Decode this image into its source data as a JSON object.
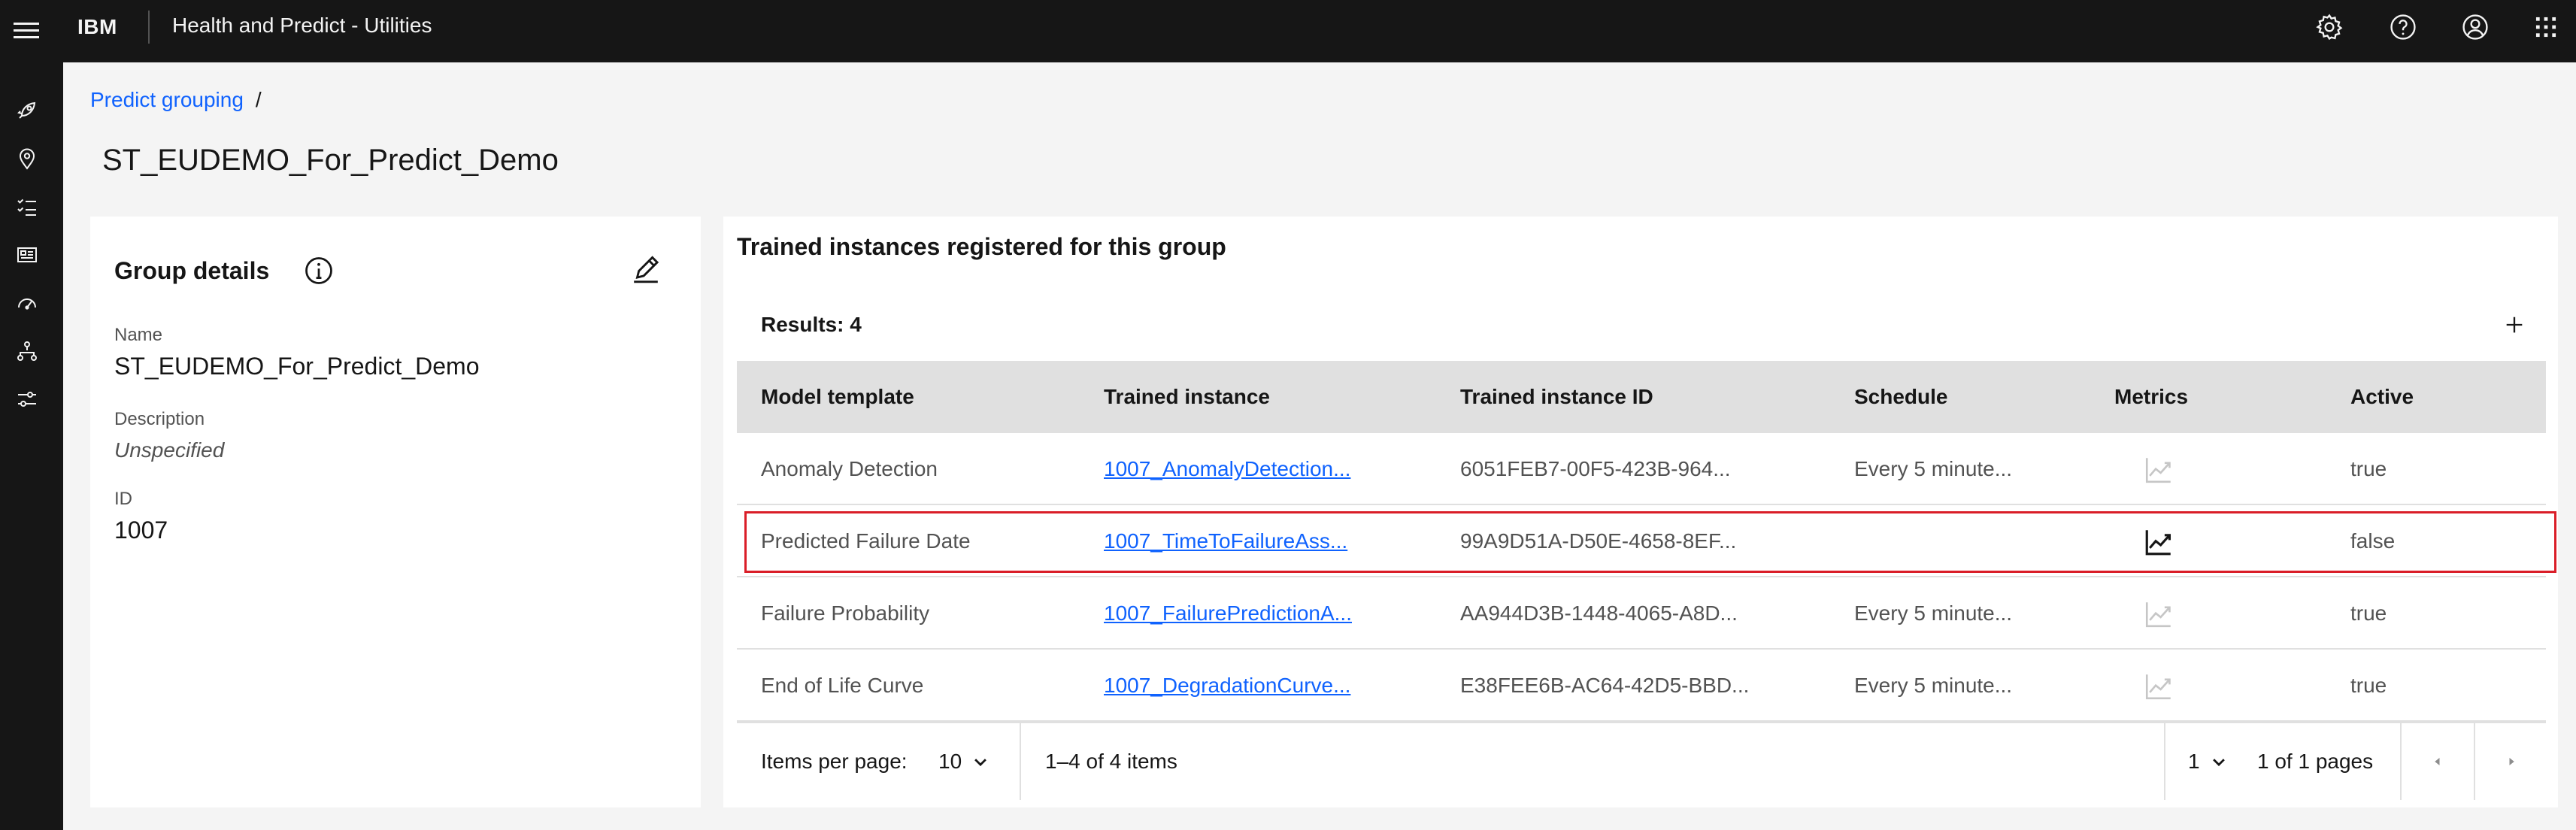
{
  "header": {
    "brand": "IBM",
    "app_title": "Health and Predict - Utilities",
    "icons": [
      "settings-icon",
      "help-icon",
      "user-avatar-icon",
      "app-switcher-icon"
    ]
  },
  "rail": {
    "icons": [
      "rocket-icon",
      "location-icon",
      "checklist-icon",
      "dashboard-card-icon",
      "gauge-icon",
      "hierarchy-icon",
      "sliders-icon"
    ]
  },
  "breadcrumb": {
    "link": "Predict grouping",
    "separator": "/"
  },
  "page_title": "ST_EUDEMO_For_Predict_Demo",
  "group_details": {
    "title": "Group details",
    "name_label": "Name",
    "name_value": "ST_EUDEMO_For_Predict_Demo",
    "description_label": "Description",
    "description_value": "Unspecified",
    "id_label": "ID",
    "id_value": "1007"
  },
  "instances": {
    "title": "Trained instances registered for this group",
    "results": "Results: 4",
    "columns": {
      "model_template": "Model template",
      "trained_instance": "Trained instance",
      "trained_instance_id": "Trained instance ID",
      "schedule": "Schedule",
      "metrics": "Metrics",
      "active": "Active"
    },
    "rows": [
      {
        "model_template": "Anomaly Detection",
        "trained_instance": "1007_AnomalyDetection...",
        "trained_instance_id": "6051FEB7-00F5-423B-964...",
        "schedule": "Every 5 minute...",
        "metrics_enabled": false,
        "active": "true"
      },
      {
        "model_template": "Predicted Failure Date",
        "trained_instance": "1007_TimeToFailureAss...",
        "trained_instance_id": "99A9D51A-D50E-4658-8EF...",
        "schedule": "",
        "metrics_enabled": true,
        "active": "false"
      },
      {
        "model_template": "Failure Probability",
        "trained_instance": "1007_FailurePredictionA...",
        "trained_instance_id": "AA944D3B-1448-4065-A8D...",
        "schedule": "Every 5 minute...",
        "metrics_enabled": false,
        "active": "true"
      },
      {
        "model_template": "End of Life Curve",
        "trained_instance": "1007_DegradationCurve...",
        "trained_instance_id": "E38FEE6B-AC64-42D5-BBD...",
        "schedule": "Every 5 minute...",
        "metrics_enabled": false,
        "active": "true"
      }
    ]
  },
  "pagination": {
    "items_per_page_label": "Items per page:",
    "items_per_page_value": "10",
    "range_text": "1–4 of 4 items",
    "page_value": "1",
    "pages_text": "1 of 1 pages"
  },
  "colors": {
    "header_bg": "#161616",
    "link": "#0f62fe",
    "highlight": "#da1e28",
    "table_header_bg": "#e0e0e0"
  }
}
